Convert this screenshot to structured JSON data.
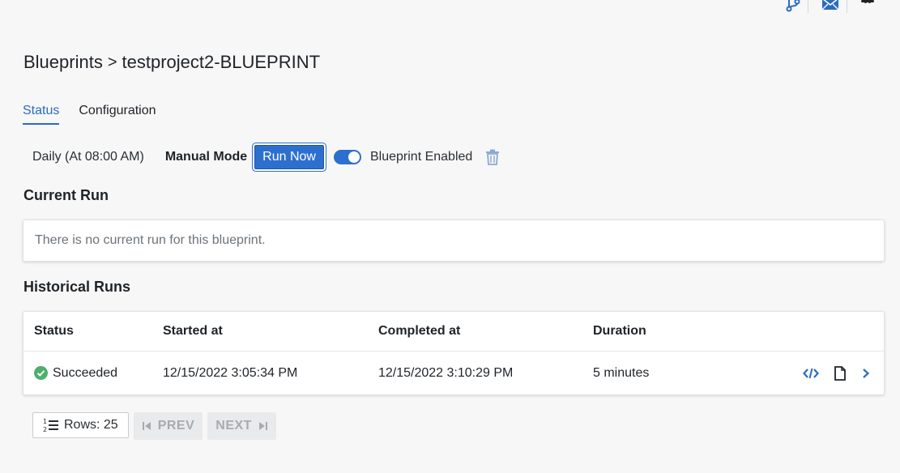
{
  "breadcrumb": {
    "root": "Blueprints",
    "separator": ">",
    "current": "testproject2-BLUEPRINT"
  },
  "tabs": [
    {
      "label": "Status",
      "active": true
    },
    {
      "label": "Configuration",
      "active": false
    }
  ],
  "controls": {
    "schedule": "Daily (At 08:00 AM)",
    "mode_label": "Manual Mode",
    "run_now_label": "Run Now",
    "enabled_label": "Blueprint Enabled",
    "enabled": true
  },
  "current_run": {
    "title": "Current Run",
    "empty_text": "There is no current run for this blueprint."
  },
  "historical_runs": {
    "title": "Historical Runs",
    "columns": [
      "Status",
      "Started at",
      "Completed at",
      "Duration"
    ],
    "rows": [
      {
        "status": "Succeeded",
        "started_at": "12/15/2022 3:05:34 PM",
        "completed_at": "12/15/2022 3:10:29 PM",
        "duration": "5 minutes"
      }
    ]
  },
  "pagination": {
    "rows_label": "Rows: 25",
    "prev_label": "PREV",
    "next_label": "NEXT"
  },
  "icons": {
    "topbar": [
      "git-branch-icon",
      "mail-icon",
      "slack-icon"
    ],
    "row_actions": [
      "code-icon",
      "document-icon",
      "chevron-right-icon"
    ]
  },
  "colors": {
    "accent": "#2d6fce",
    "success": "#4caf6a",
    "trash": "#8aa8d6"
  }
}
